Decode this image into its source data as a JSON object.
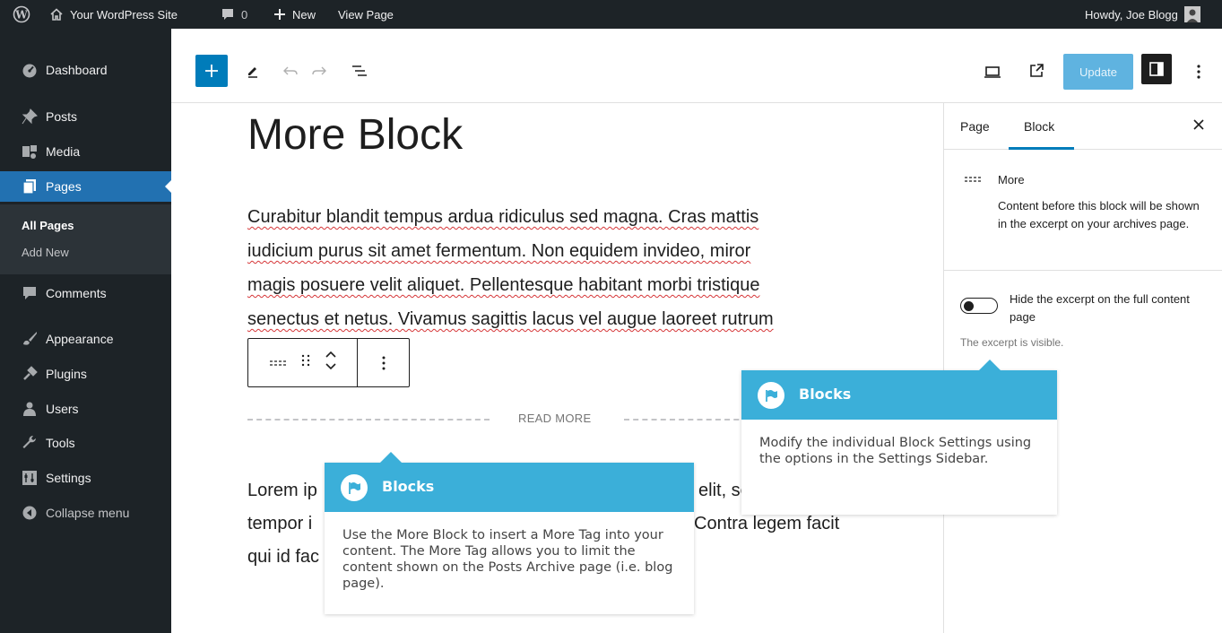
{
  "admin_bar": {
    "site_name": "Your WordPress Site",
    "comments_count": "0",
    "new_label": "New",
    "view_page_label": "View Page",
    "greeting": "Howdy, Joe Blogg"
  },
  "sidebar": {
    "items": [
      {
        "label": "Dashboard",
        "icon": "dashboard-icon"
      },
      {
        "label": "Posts",
        "icon": "pin-icon"
      },
      {
        "label": "Media",
        "icon": "media-icon"
      },
      {
        "label": "Pages",
        "icon": "pages-icon"
      },
      {
        "label": "Comments",
        "icon": "comment-icon"
      },
      {
        "label": "Appearance",
        "icon": "brush-icon"
      },
      {
        "label": "Plugins",
        "icon": "plug-icon"
      },
      {
        "label": "Users",
        "icon": "users-icon"
      },
      {
        "label": "Tools",
        "icon": "wrench-icon"
      },
      {
        "label": "Settings",
        "icon": "settings-icon"
      },
      {
        "label": "Collapse menu",
        "icon": "collapse-icon"
      }
    ],
    "submenu": [
      "All Pages",
      "Add New"
    ]
  },
  "toolbar": {
    "update_label": "Update"
  },
  "editor": {
    "title": "More Block",
    "paragraph1_lines": [
      "Curabitur blandit tempus ardua ridiculus sed magna. Cras mattis",
      "iudicium purus sit amet fermentum. Non equidem invideo, miror",
      "magis posuere velit aliquet. Pellentesque habitant morbi tristique",
      "senectus et netus. Vivamus sagittis lacus vel augue laoreet rutrum"
    ],
    "more_label": "READ MORE",
    "paragraph2_lines": [
      "Lorem ip",
      "elit, se",
      "tempor i",
      "Contra legem facit",
      "qui id fac"
    ]
  },
  "settings_sidebar": {
    "tabs": [
      "Page",
      "Block"
    ],
    "block_name": "More",
    "block_description": "Content before this block will be shown in the excerpt on your archives page.",
    "toggle_label": "Hide the excerpt on the full content page",
    "help_text": "The excerpt is visible."
  },
  "callouts": {
    "more_block": {
      "title": "Blocks",
      "body": "Use the More Block to insert a More Tag into your content. The More Tag allows you to limit the content shown on the Posts Archive page (i.e. blog page)."
    },
    "settings": {
      "title": "Blocks",
      "body": "Modify the individual Block Settings using the options in the Settings Sidebar."
    }
  },
  "colors": {
    "admin_bg": "#1d2327",
    "active_menu": "#2271b1",
    "wp_blue": "#007cba",
    "callout_header": "#3bafd9",
    "spellcheck": "#d63638"
  }
}
